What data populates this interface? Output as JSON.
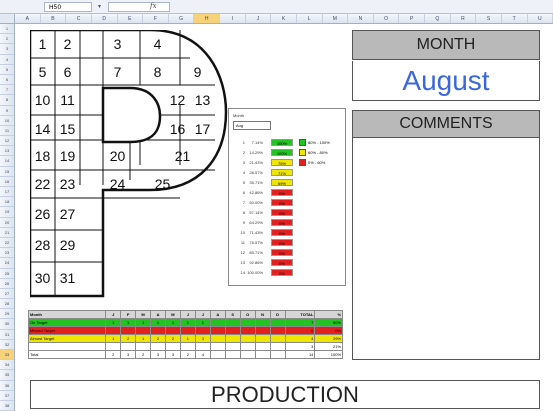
{
  "formula_bar": {
    "name_box": "H50",
    "fx": "fx"
  },
  "column_headers": [
    "A",
    "B",
    "C",
    "D",
    "E",
    "F",
    "G",
    "H",
    "I",
    "J",
    "K",
    "L",
    "M",
    "N",
    "O",
    "P",
    "Q",
    "R",
    "S",
    "T",
    "U"
  ],
  "selected_column": 7,
  "row_count": 38,
  "selected_row": 33,
  "calendar": {
    "days": [
      "1",
      "2",
      "3",
      "4",
      "5",
      "6",
      "7",
      "8",
      "9",
      "10",
      "11",
      "12",
      "13",
      "14",
      "15",
      "16",
      "17",
      "18",
      "19",
      "20",
      "21",
      "22",
      "23",
      "24",
      "25",
      "26",
      "27",
      "28",
      "29",
      "30",
      "31"
    ]
  },
  "widget": {
    "title": "Month",
    "selector": "Aug",
    "rows": [
      {
        "n": "1",
        "pct": "7.14%",
        "bar": "100%",
        "status": "green"
      },
      {
        "n": "2",
        "pct": "14.29%",
        "bar": "100%",
        "status": "green"
      },
      {
        "n": "3",
        "pct": "21.43%",
        "bar": "75%",
        "status": "yellow"
      },
      {
        "n": "4",
        "pct": "28.57%",
        "bar": "71%",
        "status": "yellow"
      },
      {
        "n": "5",
        "pct": "35.71%",
        "bar": "69%",
        "status": "yellow"
      },
      {
        "n": "6",
        "pct": "42.86%",
        "bar": "0%",
        "status": "red"
      },
      {
        "n": "7",
        "pct": "50.00%",
        "bar": "0%",
        "status": "red"
      },
      {
        "n": "8",
        "pct": "57.14%",
        "bar": "0%",
        "status": "red"
      },
      {
        "n": "9",
        "pct": "64.29%",
        "bar": "0%",
        "status": "red"
      },
      {
        "n": "10",
        "pct": "71.43%",
        "bar": "0%",
        "status": "red"
      },
      {
        "n": "11",
        "pct": "78.57%",
        "bar": "0%",
        "status": "red"
      },
      {
        "n": "12",
        "pct": "85.71%",
        "bar": "0%",
        "status": "red"
      },
      {
        "n": "13",
        "pct": "92.86%",
        "bar": "0%",
        "status": "red"
      },
      {
        "n": "14",
        "pct": "100.00%",
        "bar": "0%",
        "status": "red"
      }
    ],
    "legend": [
      {
        "label": "80% - 100%",
        "color": "#22c322"
      },
      {
        "label": "60% - 80%",
        "color": "#efe600"
      },
      {
        "label": "0% - 60%",
        "color": "#e32020"
      }
    ]
  },
  "month_panel": {
    "heading": "MONTH",
    "value": "August"
  },
  "comments_panel": {
    "heading": "COMMENTS"
  },
  "summary": {
    "headers": [
      "Month",
      "J",
      "F",
      "M",
      "A",
      "M",
      "J",
      "J",
      "A",
      "S",
      "O",
      "N",
      "D",
      "TOTAL",
      "%"
    ],
    "rows": [
      {
        "label": "On Target",
        "cells": [
          "1",
          "1",
          "1",
          "1",
          "1",
          "1",
          "1",
          "",
          "",
          "",
          "",
          ""
        ],
        "total": "7",
        "pct": "50%",
        "style": "green"
      },
      {
        "label": "Missed Target",
        "cells": [
          "",
          "",
          "",
          "",
          "",
          "",
          "",
          "",
          "",
          "",
          "",
          ""
        ],
        "total": "0",
        "pct": "0%",
        "style": "red"
      },
      {
        "label": "Almost Target",
        "cells": [
          "1",
          "2",
          "1",
          "2",
          "2",
          "1",
          "3",
          "",
          "",
          "",
          "",
          ""
        ],
        "total": "4",
        "pct": "29%",
        "style": "yellow"
      },
      {
        "label": "",
        "cells": [
          "",
          "",
          "",
          "",
          "",
          "",
          "",
          "",
          "",
          "",
          "",
          ""
        ],
        "total": "3",
        "pct": "21%",
        "style": "white"
      },
      {
        "label": "Total",
        "cells": [
          "2",
          "3",
          "2",
          "3",
          "3",
          "2",
          "4",
          "",
          "",
          "",
          "",
          ""
        ],
        "total": "14",
        "pct": "100%",
        "style": "white"
      }
    ]
  },
  "banner": {
    "text": "PRODUCTION"
  },
  "colors": {
    "accent_month": "#3c66dc",
    "green": "#22c322",
    "yellow": "#efe600",
    "red": "#e32020",
    "panel_gray": "#b9b9b9"
  }
}
